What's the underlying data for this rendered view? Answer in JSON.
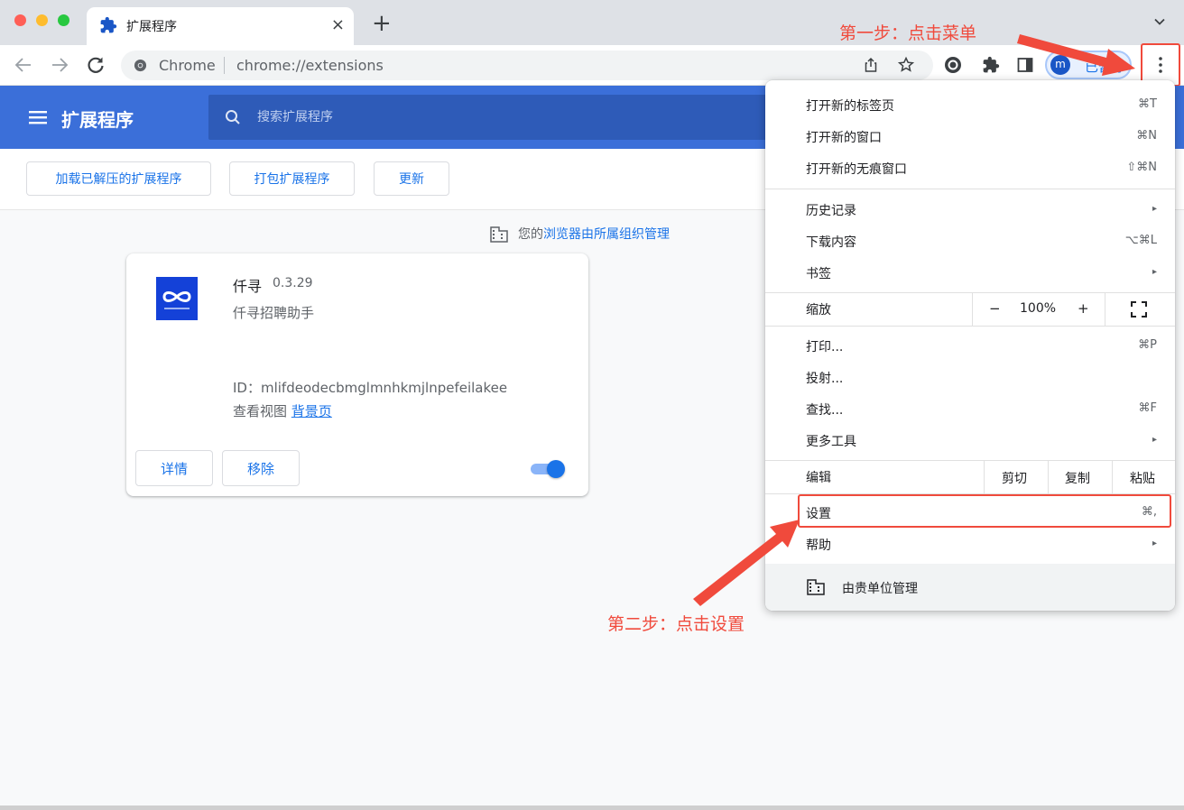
{
  "browser": {
    "tab_title": "扩展程序",
    "tab_close": "×",
    "new_tab": "+",
    "omnibox_site": "Chrome",
    "omnibox_url": "chrome://extensions",
    "profile_initial": "m",
    "profile_label": "已暂停"
  },
  "header": {
    "title": "扩展程序",
    "search_placeholder": "搜索扩展程序"
  },
  "actions": {
    "load_unpacked": "加载已解压的扩展程序",
    "pack": "打包扩展程序",
    "update": "更新"
  },
  "managed_notice": {
    "prefix": "您的",
    "link": "浏览器由所属组织管理"
  },
  "extension": {
    "name": "仟寻",
    "version": "0.3.29",
    "description": "仟寻招聘助手",
    "id_line": "ID：mlifdeodecbmglmnhkmjlnpefeilakee",
    "views_label": "查看视图",
    "views_link": "背景页",
    "details_button": "详情",
    "remove_button": "移除",
    "enabled": true
  },
  "menu": {
    "new_tab": {
      "label": "打开新的标签页",
      "shortcut": "⌘T"
    },
    "new_window": {
      "label": "打开新的窗口",
      "shortcut": "⌘N"
    },
    "new_incognito": {
      "label": "打开新的无痕窗口",
      "shortcut": "⇧⌘N"
    },
    "history": {
      "label": "历史记录",
      "arrow": "▸"
    },
    "downloads": {
      "label": "下载内容",
      "shortcut": "⌥⌘L"
    },
    "bookmarks": {
      "label": "书签",
      "arrow": "▸"
    },
    "zoom": {
      "label": "缩放",
      "minus": "−",
      "value": "100%",
      "plus": "+"
    },
    "print": {
      "label": "打印...",
      "shortcut": "⌘P"
    },
    "cast": {
      "label": "投射..."
    },
    "find": {
      "label": "查找...",
      "shortcut": "⌘F"
    },
    "more_tools": {
      "label": "更多工具",
      "arrow": "▸"
    },
    "edit": {
      "label": "编辑",
      "cut": "剪切",
      "copy": "复制",
      "paste": "粘贴"
    },
    "settings": {
      "label": "设置",
      "shortcut": "⌘,"
    },
    "help": {
      "label": "帮助",
      "arrow": "▸"
    },
    "managed": {
      "label": "由贵单位管理"
    }
  },
  "annotations": {
    "step1": "第一步：点击菜单",
    "step2": "第二步：点击设置",
    "color": "#f04a3c"
  },
  "colors": {
    "header_bg": "#3b6fd9",
    "accent": "#1a73e8"
  }
}
